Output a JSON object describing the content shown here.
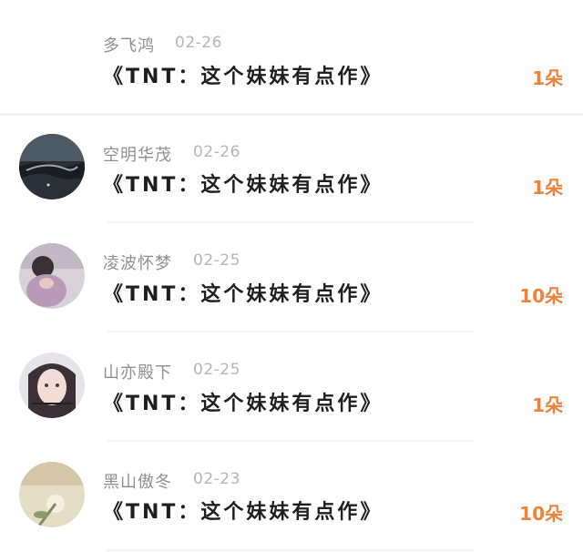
{
  "items": [
    {
      "name": "多飞鸿",
      "date": "02-26",
      "title": "《TNT：这个妹妹有点作》",
      "count": "1朵",
      "has_avatar": false
    },
    {
      "name": "空明华茂",
      "date": "02-26",
      "title": "《TNT：这个妹妹有点作》",
      "count": "1朵",
      "has_avatar": true
    },
    {
      "name": "凌波怀梦",
      "date": "02-25",
      "title": "《TNT：这个妹妹有点作》",
      "count": "10朵",
      "has_avatar": true
    },
    {
      "name": "山亦殿下",
      "date": "02-25",
      "title": "《TNT：这个妹妹有点作》",
      "count": "1朵",
      "has_avatar": true
    },
    {
      "name": "黑山傲冬",
      "date": "02-23",
      "title": "《TNT：这个妹妹有点作》",
      "count": "10朵",
      "has_avatar": true
    }
  ],
  "colors": {
    "count": "#f0813a",
    "title": "#1f1f1f",
    "meta": "#8f8f8f"
  }
}
